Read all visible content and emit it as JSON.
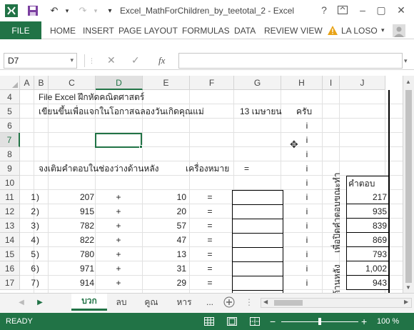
{
  "window": {
    "title": "Excel_MathForChildren_by_teetotal_2 - Excel",
    "help_label": "?",
    "minimize_label": "–",
    "restore_label": "▢",
    "close_label": "✕"
  },
  "ribbon": {
    "file_label": "FILE",
    "tabs": [
      "HOME",
      "INSERT",
      "PAGE LAYOUT",
      "FORMULAS",
      "DATA",
      "REVIEW",
      "VIEW"
    ],
    "user": "LA LOSO"
  },
  "formula_bar": {
    "name_box": "D7",
    "fx": "fx",
    "value": ""
  },
  "columns": [
    "A",
    "B",
    "C",
    "D",
    "E",
    "F",
    "G",
    "H",
    "I",
    "J"
  ],
  "selected_column": "D",
  "rows": [
    "4",
    "5",
    "6",
    "7",
    "8",
    "9",
    "10",
    "11",
    "12",
    "13",
    "14",
    "15",
    "16",
    "17"
  ],
  "selected_row": "7",
  "sheet": {
    "line1": "File Excel ฝึกหัดคณิตศาสตร์",
    "line2": "เขียนขึ้นเพื่อแจกในโอกาสฉลองวันเกิดคุณแม่",
    "date": "13 เมษายน",
    "krub": "ครับ",
    "instruction": "จงเติมคำตอบในช่องว่างด้านหลัง",
    "sign_label": "เครื่องหมาย",
    "sign_eq": "=",
    "answer_header": "คำตอบ",
    "vertical_text_1": "เพื่อปิดคำตอบขณะทำ",
    "vertical_text_2": "ด้านหลัง",
    "marker": "i",
    "problems": [
      {
        "n": "1",
        "paren": ")",
        "a": "207",
        "op": "+",
        "b": "10",
        "eq": "=",
        "ans": "217"
      },
      {
        "n": "2",
        "paren": ")",
        "a": "915",
        "op": "+",
        "b": "20",
        "eq": "=",
        "ans": "935"
      },
      {
        "n": "3",
        "paren": ")",
        "a": "782",
        "op": "+",
        "b": "57",
        "eq": "=",
        "ans": "839"
      },
      {
        "n": "4",
        "paren": ")",
        "a": "822",
        "op": "+",
        "b": "47",
        "eq": "=",
        "ans": "869"
      },
      {
        "n": "5",
        "paren": ")",
        "a": "780",
        "op": "+",
        "b": "13",
        "eq": "=",
        "ans": "793"
      },
      {
        "n": "6",
        "paren": ")",
        "a": "971",
        "op": "+",
        "b": "31",
        "eq": "=",
        "ans": "1,002"
      },
      {
        "n": "7",
        "paren": ")",
        "a": "914",
        "op": "+",
        "b": "29",
        "eq": "=",
        "ans": "943"
      }
    ]
  },
  "sheet_tabs": [
    "บวก",
    "ลบ",
    "คูณ",
    "หาร",
    "..."
  ],
  "active_sheet": "บวก",
  "status": {
    "ready": "READY",
    "zoom": "100 %",
    "minus": "−",
    "plus": "+"
  },
  "colors": {
    "accent": "#217346"
  }
}
